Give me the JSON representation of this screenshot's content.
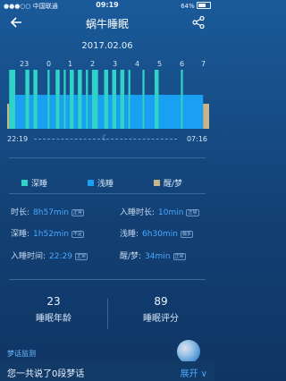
{
  "status_bar": {
    "carrier": "中国联通",
    "time": "09:19",
    "battery": "64%"
  },
  "header": {
    "title": "蜗牛睡眠",
    "back_icon": "back-arrow-icon",
    "share_icon": "share-icon"
  },
  "date": "2017.02.06",
  "chart_data": {
    "type": "bar",
    "hour_labels": [
      "23",
      "0",
      "1",
      "2",
      "3",
      "4",
      "5",
      "6",
      "7"
    ],
    "start_time": "22:19",
    "end_time": "07:16",
    "segments": [
      {
        "stage": "awake",
        "start": 0,
        "end": 1
      },
      {
        "stage": "deep",
        "start": 1,
        "end": 4
      },
      {
        "stage": "light",
        "start": 4,
        "end": 9
      },
      {
        "stage": "deep",
        "start": 9,
        "end": 11
      },
      {
        "stage": "light",
        "start": 11,
        "end": 13
      },
      {
        "stage": "deep",
        "start": 13,
        "end": 15
      },
      {
        "stage": "light",
        "start": 15,
        "end": 20
      },
      {
        "stage": "deep",
        "start": 20,
        "end": 21
      },
      {
        "stage": "light",
        "start": 21,
        "end": 24
      },
      {
        "stage": "deep",
        "start": 24,
        "end": 26
      },
      {
        "stage": "light",
        "start": 26,
        "end": 28
      },
      {
        "stage": "deep",
        "start": 28,
        "end": 29
      },
      {
        "stage": "light",
        "start": 29,
        "end": 31
      },
      {
        "stage": "deep",
        "start": 31,
        "end": 33
      },
      {
        "stage": "light",
        "start": 33,
        "end": 35
      },
      {
        "stage": "deep",
        "start": 35,
        "end": 37
      },
      {
        "stage": "light",
        "start": 37,
        "end": 39
      },
      {
        "stage": "deep",
        "start": 39,
        "end": 40
      },
      {
        "stage": "light",
        "start": 40,
        "end": 42
      },
      {
        "stage": "deep",
        "start": 42,
        "end": 45
      },
      {
        "stage": "light",
        "start": 45,
        "end": 48
      },
      {
        "stage": "deep",
        "start": 48,
        "end": 50
      },
      {
        "stage": "light",
        "start": 50,
        "end": 52
      },
      {
        "stage": "deep",
        "start": 52,
        "end": 54
      },
      {
        "stage": "light",
        "start": 54,
        "end": 56
      },
      {
        "stage": "deep",
        "start": 56,
        "end": 58
      },
      {
        "stage": "light",
        "start": 58,
        "end": 60
      },
      {
        "stage": "deep",
        "start": 60,
        "end": 61
      },
      {
        "stage": "light",
        "start": 61,
        "end": 67
      },
      {
        "stage": "deep",
        "start": 67,
        "end": 68
      },
      {
        "stage": "light",
        "start": 68,
        "end": 73
      },
      {
        "stage": "deep",
        "start": 73,
        "end": 75
      },
      {
        "stage": "light",
        "start": 75,
        "end": 86
      },
      {
        "stage": "deep",
        "start": 86,
        "end": 87
      },
      {
        "stage": "light",
        "start": 87,
        "end": 97
      },
      {
        "stage": "awake",
        "start": 97,
        "end": 100
      }
    ],
    "stage_colors": {
      "deep": "#2fd3c8",
      "light": "#1aa0f2",
      "awake": "#c6b48b"
    },
    "legend": [
      {
        "key": "deep",
        "label": "深睡"
      },
      {
        "key": "light",
        "label": "浅睡"
      },
      {
        "key": "awake",
        "label": "醒/梦"
      }
    ]
  },
  "stats": {
    "duration_label": "时长:",
    "duration_value": "8h57min",
    "duration_badge": "正常",
    "fall_asleep_label": "入睡时长:",
    "fall_asleep_value": "10min",
    "fall_asleep_badge": "正常",
    "deep_label": "深睡:",
    "deep_value": "1h52min",
    "deep_badge": "不足",
    "light_label": "浅睡:",
    "light_value": "6h30min",
    "light_badge": "偏多",
    "bedtime_label": "入睡时间:",
    "bedtime_value": "22:29",
    "bedtime_badge": "正常",
    "awake_label": "醒/梦:",
    "awake_value": "34min",
    "awake_badge": "正常"
  },
  "metrics": {
    "sleep_age_value": "23",
    "sleep_age_label": "睡眠年龄",
    "sleep_score_value": "89",
    "sleep_score_label": "睡眠评分"
  },
  "dream": {
    "section_label": "梦话监测",
    "summary": "您一共说了0段梦话",
    "expand_label": "展开 ∨"
  },
  "colors": {
    "accent": "#4aa8ff",
    "background_top": "#1a5a9a",
    "background_bottom": "#0f3563"
  }
}
